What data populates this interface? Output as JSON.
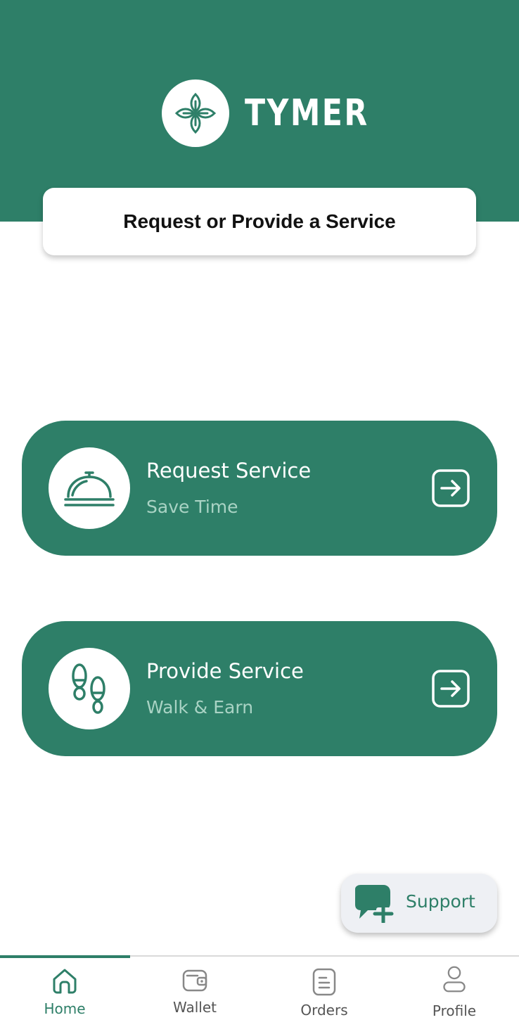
{
  "app": {
    "brand": "TYMER",
    "title": "Request or Provide a Service"
  },
  "colors": {
    "primary": "#2e7f68",
    "subtitle": "#a9d3c4",
    "white": "#ffffff",
    "support_bg": "#eef0f4"
  },
  "cards": [
    {
      "title": "Request Service",
      "subtitle": "Save Time",
      "icon": "cloche-icon",
      "action_icon": "arrow-right-square-icon"
    },
    {
      "title": "Provide Service",
      "subtitle": "Walk & Earn",
      "icon": "footprints-icon",
      "action_icon": "arrow-right-square-icon"
    }
  ],
  "support": {
    "label": "Support",
    "icon": "chat-plus-icon"
  },
  "nav": {
    "active": "Home",
    "items": [
      {
        "label": "Home",
        "icon": "home-icon"
      },
      {
        "label": "Wallet",
        "icon": "wallet-icon"
      },
      {
        "label": "Orders",
        "icon": "orders-icon"
      },
      {
        "label": "Profile",
        "icon": "profile-icon"
      }
    ]
  }
}
